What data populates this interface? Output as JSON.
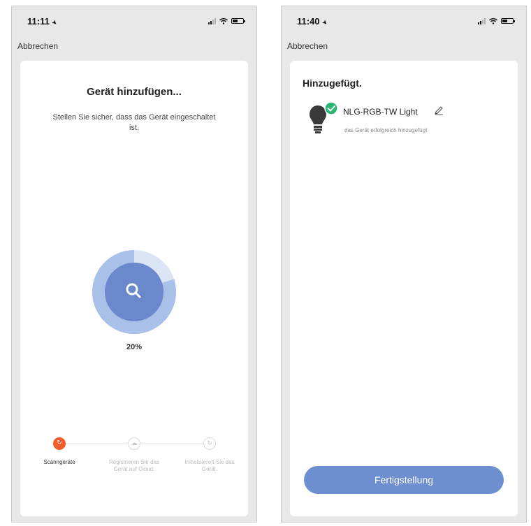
{
  "colors": {
    "accent": "#6e8fcf",
    "step_active": "#f25b2a",
    "success": "#2bb673",
    "scan_outer": "#c5d5f0",
    "scan_inner": "#6a88cb"
  },
  "left_screen": {
    "status": {
      "time": "11:11"
    },
    "cancel_label": "Abbrechen",
    "title": "Gerät hinzufügen...",
    "subtitle": "Stellen Sie sicher, dass das Gerät eingeschaltet ist.",
    "scan": {
      "icon": "search-icon",
      "progress_percent": 20,
      "progress_label": "20%"
    },
    "steps": [
      {
        "label": "Scanngeräte",
        "icon": "scan-icon",
        "active": true
      },
      {
        "label": "Registrieren Sie das Gerät auf Cloud.",
        "icon": "cloud-icon",
        "active": false
      },
      {
        "label": "Initialisieren Sie das Gerät.",
        "icon": "init-icon",
        "active": false
      }
    ]
  },
  "right_screen": {
    "status": {
      "time": "11:40"
    },
    "cancel_label": "Abbrechen",
    "title": "Hinzugefügt.",
    "device": {
      "name": "NLG-RGB-TW Light",
      "status": "das Gerät erfolgreich hinzugefügt",
      "icon": "lightbulb-icon",
      "badge_icon": "checkmark-icon"
    },
    "finish_label": "Fertigstellung"
  }
}
